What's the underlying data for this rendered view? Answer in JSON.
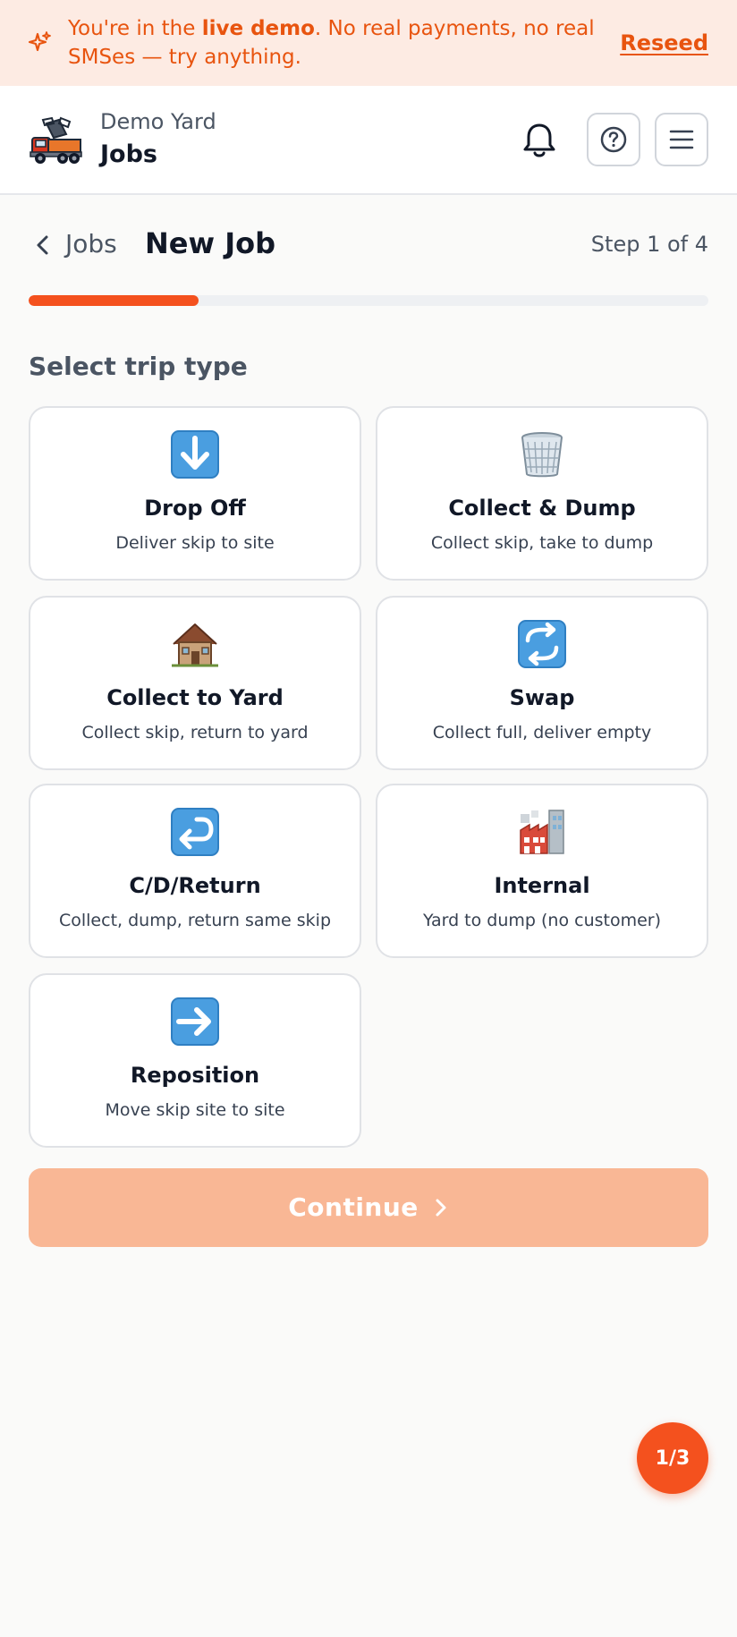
{
  "banner": {
    "text_before": "You're in the ",
    "text_bold": "live demo",
    "text_after": ". No real payments, no real SMSes — try anything.",
    "reseed_label": "Reseed"
  },
  "header": {
    "yard_name": "Demo Yard",
    "title": "Jobs",
    "icons": [
      "truck-logo",
      "bell-icon",
      "help-icon",
      "menu-icon"
    ]
  },
  "page": {
    "back_label": "Jobs",
    "title": "New Job",
    "step_text": "Step 1 of 4",
    "progress": 0.25
  },
  "section_label": "Select trip type",
  "trip_types": [
    {
      "emoji": "⬇️",
      "title": "Drop Off",
      "desc": "Deliver skip to site"
    },
    {
      "emoji": "🗑️",
      "title": "Collect & Dump",
      "desc": "Collect skip, take to dump"
    },
    {
      "emoji": "🏚️",
      "title": "Collect to Yard",
      "desc": "Collect skip, return to yard"
    },
    {
      "emoji": "🔄",
      "title": "Swap",
      "desc": "Collect full, deliver empty"
    },
    {
      "emoji": "↩️",
      "title": "C/D/Return",
      "desc": "Collect, dump, return same skip"
    },
    {
      "emoji": "🏭",
      "title": "Internal",
      "desc": "Yard to dump (no customer)"
    },
    {
      "emoji": "➡️",
      "title": "Reposition",
      "desc": "Move skip site to site"
    }
  ],
  "continue_label": "Continue",
  "fab_label": "1/3",
  "colors": {
    "accent": "#f4511e",
    "banner_bg": "#fdebe3",
    "continue_disabled": "#f9b795"
  }
}
